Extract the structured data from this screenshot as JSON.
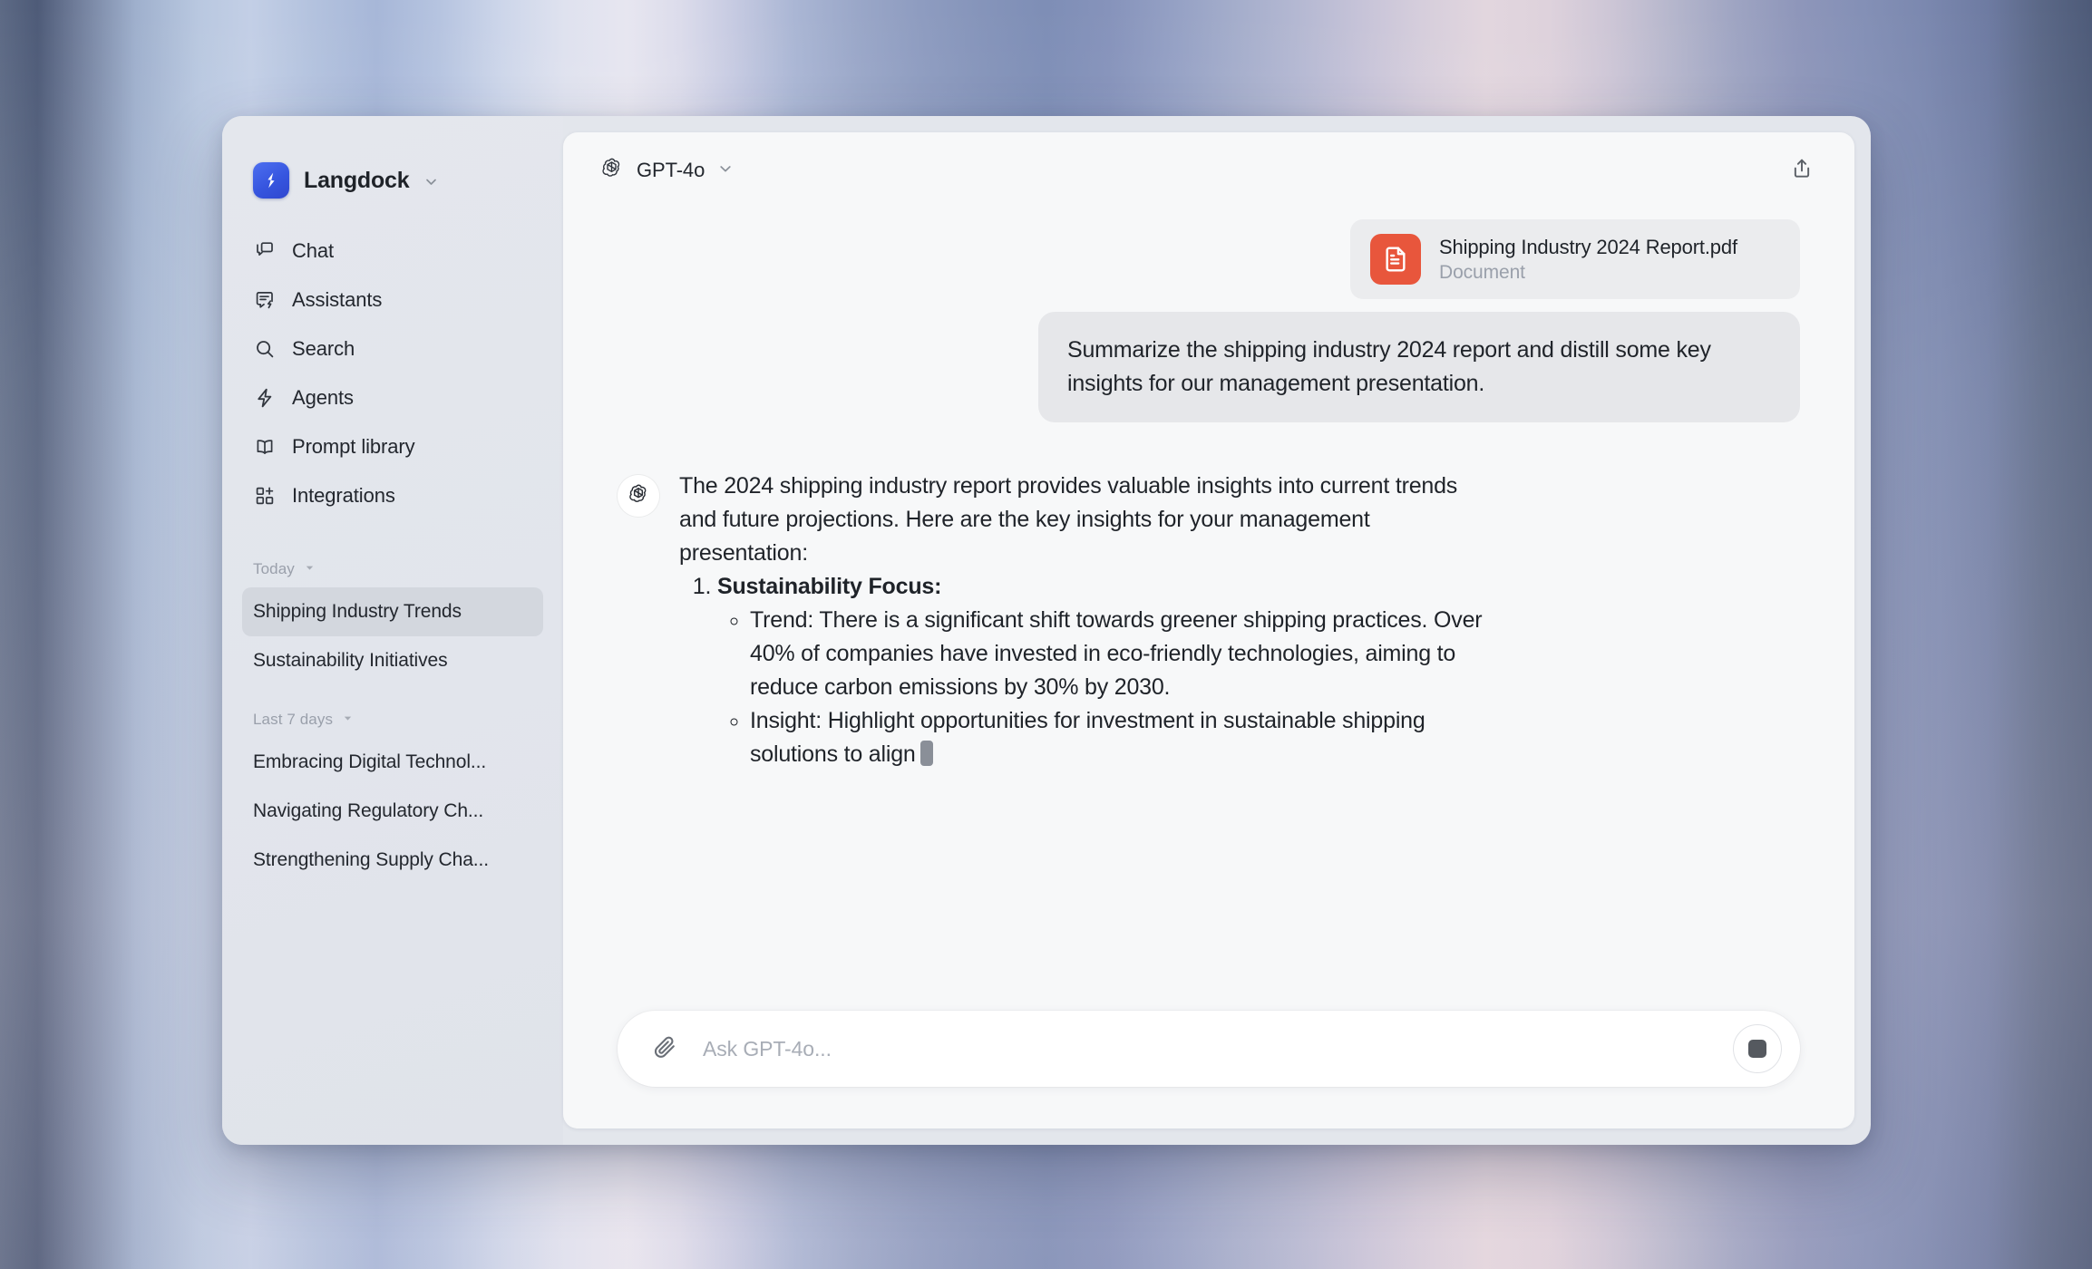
{
  "brand": {
    "name": "Langdock",
    "logo_icon": "langdock-logo-icon",
    "caret_icon": "chevron-down-icon"
  },
  "sidebar": {
    "nav": [
      {
        "label": "Chat",
        "icon": "chat-bubbles-icon"
      },
      {
        "label": "Assistants",
        "icon": "assistant-bubble-icon"
      },
      {
        "label": "Search",
        "icon": "search-icon"
      },
      {
        "label": "Agents",
        "icon": "lightning-bolt-icon"
      },
      {
        "label": "Prompt library",
        "icon": "book-icon"
      },
      {
        "label": "Integrations",
        "icon": "grid-plus-icon"
      }
    ],
    "history_groups": [
      {
        "title": "Today",
        "caret_icon": "triangle-down-icon",
        "items": [
          {
            "label": "Shipping Industry Trends",
            "active": true
          },
          {
            "label": "Sustainability Initiatives",
            "active": false
          }
        ]
      },
      {
        "title": "Last 7 days",
        "caret_icon": "triangle-down-icon",
        "items": [
          {
            "label": "Embracing Digital Technol...",
            "active": false
          },
          {
            "label": "Navigating Regulatory Ch...",
            "active": false
          },
          {
            "label": "Strengthening Supply Cha...",
            "active": false
          }
        ]
      }
    ]
  },
  "header": {
    "model_name": "GPT-4o",
    "model_icon": "openai-logo-icon",
    "model_caret_icon": "chevron-down-icon",
    "share_icon": "share-icon"
  },
  "conversation": {
    "attachment": {
      "file_name": "Shipping Industry 2024 Report.pdf",
      "file_type": "Document",
      "icon": "pdf-document-icon",
      "icon_color": "#e8563c"
    },
    "user_message": "Summarize the shipping industry 2024 report and distill some key insights for our management presentation.",
    "assistant": {
      "avatar_icon": "openai-logo-icon",
      "intro": "The 2024 shipping industry report provides valuable insights into current trends and future projections. Here are the key insights for your management presentation:",
      "list_item_1": "Sustainability Focus:",
      "bullet_1": "Trend: There is a significant shift towards greener shipping practices. Over 40% of companies have invested in eco-friendly technologies, aiming to reduce carbon emissions by 30% by 2030.",
      "bullet_2": "Insight: Highlight opportunities for investment in sustainable shipping solutions to align",
      "is_streaming": true
    }
  },
  "composer": {
    "placeholder": "Ask GPT-4o...",
    "value": "",
    "attach_icon": "paperclip-icon",
    "stop_icon": "stop-square-icon"
  }
}
